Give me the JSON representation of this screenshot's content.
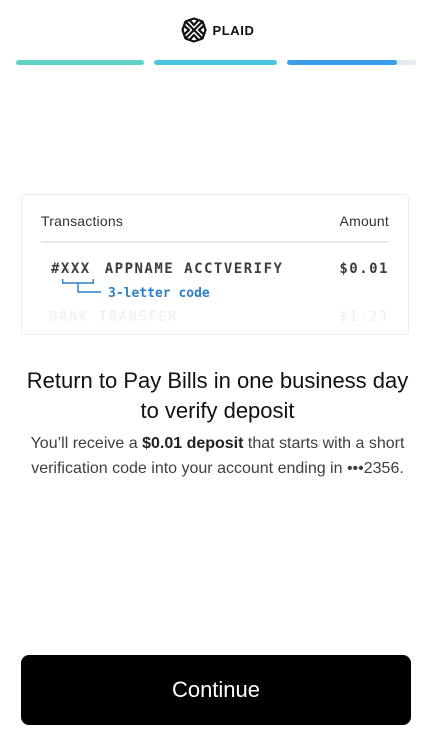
{
  "header": {
    "logo_text": "PLAID",
    "logo_icon": "plaid-logo-icon"
  },
  "progress": {
    "segments": [
      {
        "fill_percent": 100,
        "color": "#5fd3c6"
      },
      {
        "fill_percent": 100,
        "color": "#4ac5e0"
      },
      {
        "fill_percent": 85,
        "color": "#3a9ee8"
      }
    ],
    "track_color": "#e6e9ec"
  },
  "statement": {
    "header_transactions": "Transactions",
    "header_amount": "Amount",
    "main_row": {
      "code": "#XXX",
      "description": "APPNAME ACCTVERIFY",
      "amount": "$0.01"
    },
    "code_annotation": "3-letter code",
    "faded_row": {
      "description": "BANK TRANSFER",
      "amount": "$1.23"
    },
    "accent_color": "#2b7fc8"
  },
  "title": "Return to Pay Bills in one business day to verify deposit",
  "body": {
    "prefix": "You’ll receive a ",
    "bold": "$0.01 deposit",
    "suffix": " that starts with a short verification code into your account ending in •••2356."
  },
  "continue_label": "Continue"
}
